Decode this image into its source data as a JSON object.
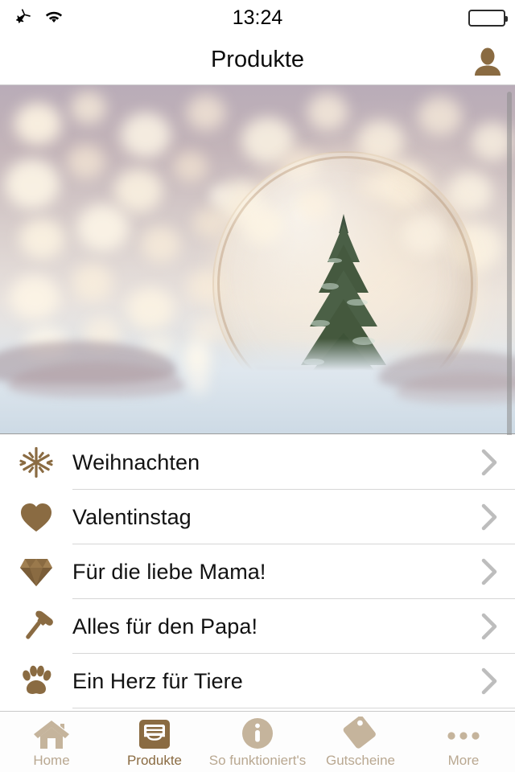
{
  "status_bar": {
    "airplane_icon": "airplane-mode-icon",
    "wifi_icon": "wifi-icon",
    "time": "13:24",
    "battery_icon": "battery-full-icon"
  },
  "nav_bar": {
    "title": "Produkte",
    "avatar_icon": "user-avatar-icon"
  },
  "hero": {
    "alt": "christmas-snow-globe-banner"
  },
  "list": {
    "items": [
      {
        "icon": "snowflake-icon",
        "label": "Weihnachten",
        "chevron": "chevron-right-icon"
      },
      {
        "icon": "heart-icon",
        "label": "Valentinstag",
        "chevron": "chevron-right-icon"
      },
      {
        "icon": "diamond-icon",
        "label": "Für die liebe Mama!",
        "chevron": "chevron-right-icon"
      },
      {
        "icon": "hammer-icon",
        "label": "Alles für den Papa!",
        "chevron": "chevron-right-icon"
      },
      {
        "icon": "paw-print-icon",
        "label": "Ein Herz für Tiere",
        "chevron": "chevron-right-icon"
      }
    ]
  },
  "tab_bar": {
    "items": [
      {
        "icon": "home-icon",
        "label": "Home",
        "active": false
      },
      {
        "icon": "products-icon",
        "label": "Produkte",
        "active": true
      },
      {
        "icon": "info-circle-icon",
        "label": "So funktioniert's",
        "active": false
      },
      {
        "icon": "tag-icon",
        "label": "Gutscheine",
        "active": false
      },
      {
        "icon": "more-dots-icon",
        "label": "More",
        "active": false
      }
    ]
  },
  "colors": {
    "accent_brown": "#8a6b42",
    "tab_inactive": "#c5b49c",
    "tab_active_label": "#8a6b42",
    "separator": "#d6d6d6",
    "chevron": "#bdbdbd",
    "text_primary": "#121212"
  }
}
